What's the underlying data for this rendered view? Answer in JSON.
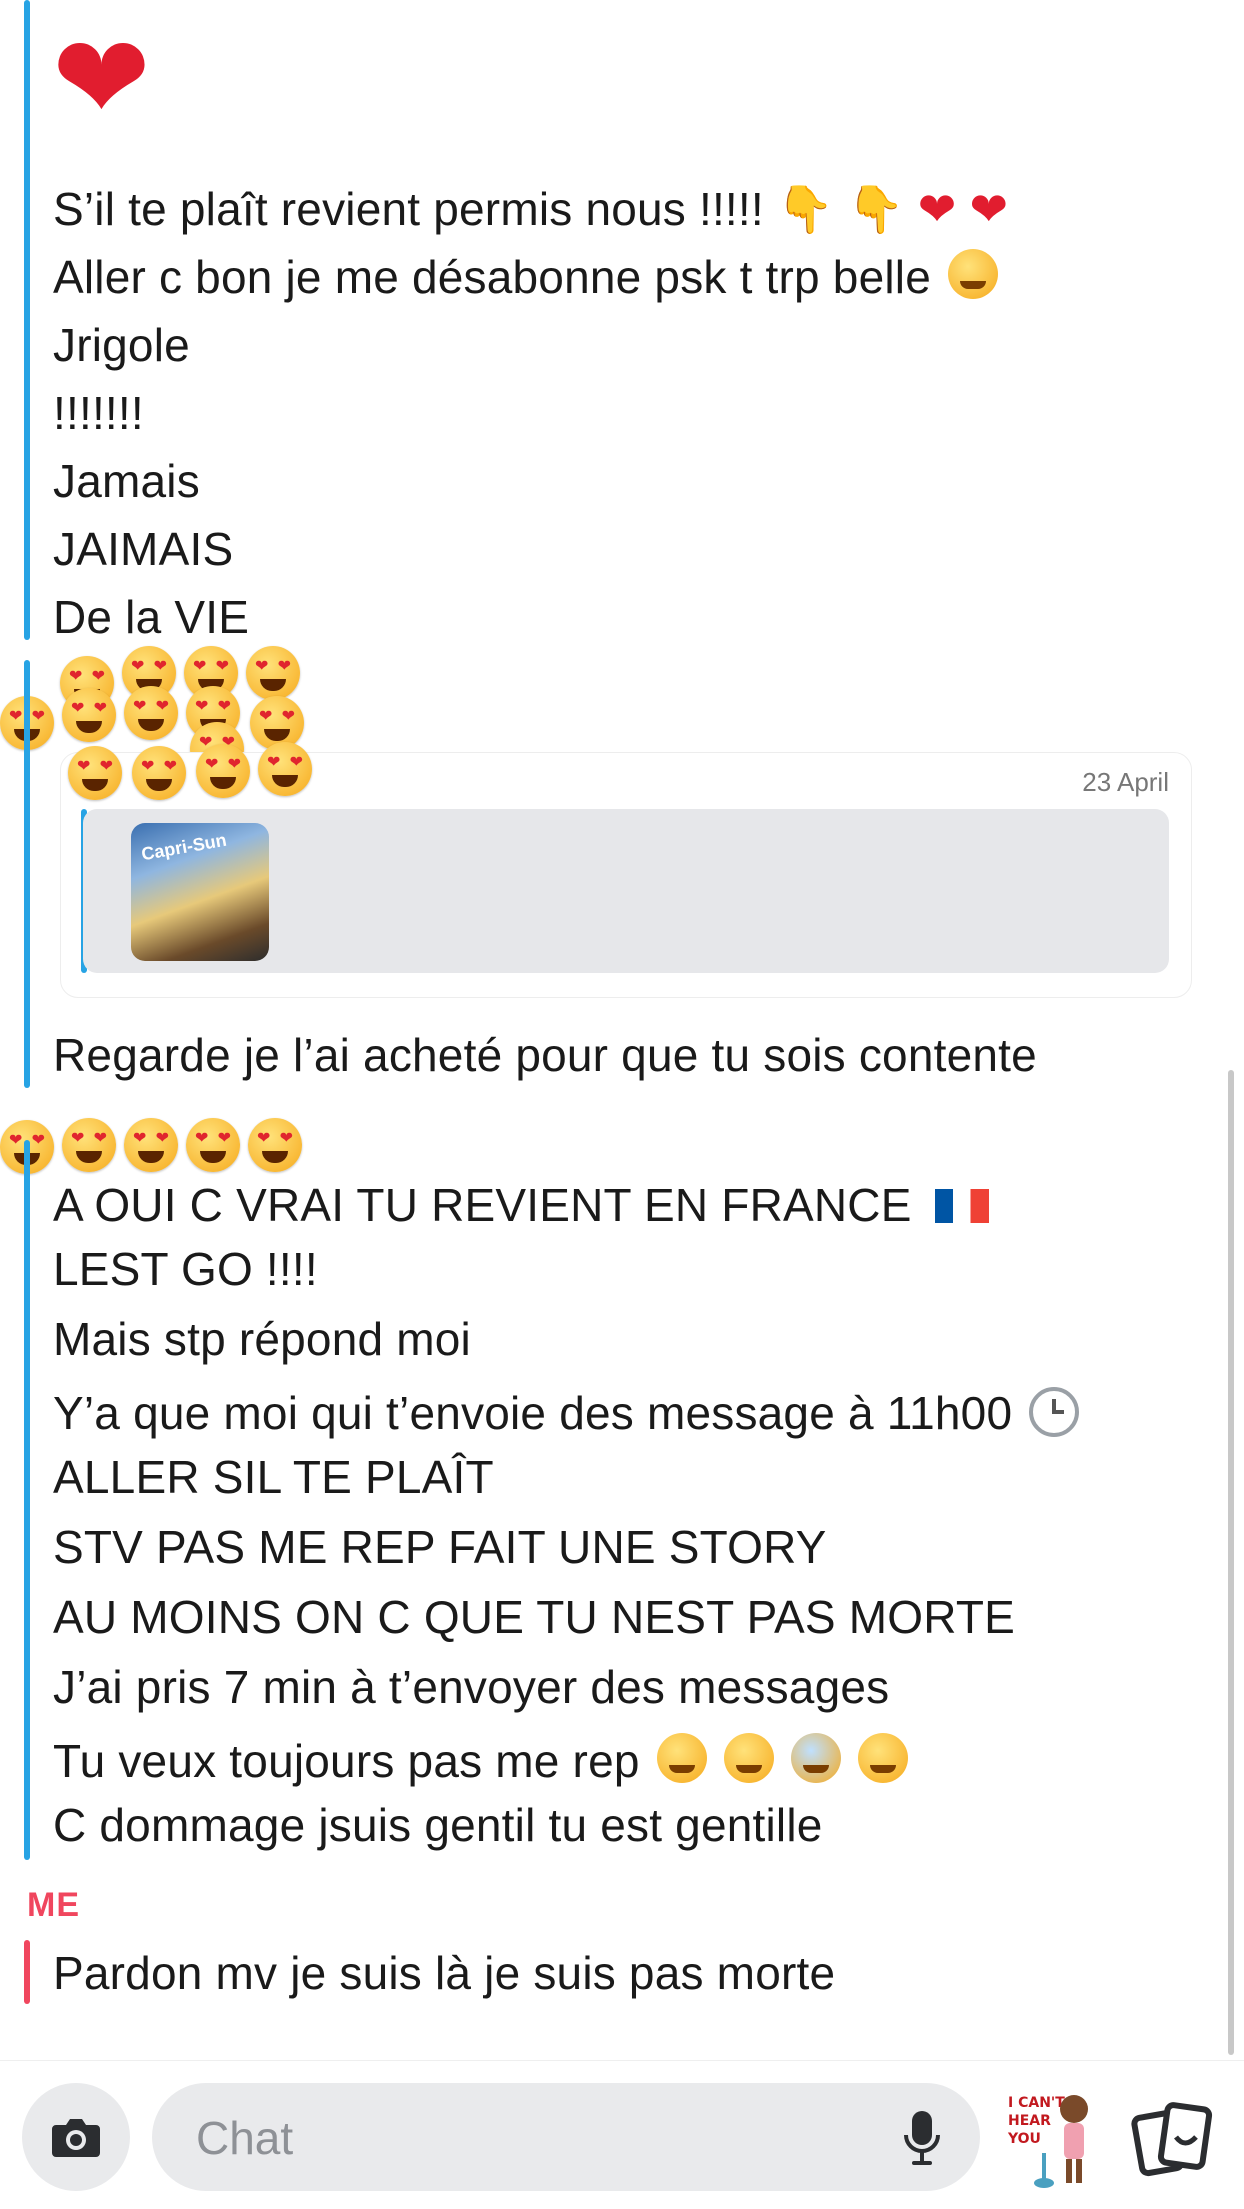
{
  "thread": {
    "big_heart": "❤",
    "block1": [
      "S’il te plaît revient permis nous !!!!!",
      "Aller c bon je me désabonne psk t trp belle",
      "Jrigole",
      "!!!!!!!",
      "Jamais",
      "JAIMAIS",
      "De la VIE"
    ],
    "block1_emoji": {
      "line1": "👇 👇 ❤ ❤",
      "line2": "🥰"
    },
    "shared_card": {
      "date": "23 April",
      "thumb_text": "Capri-Sun"
    },
    "block2": [
      "Regarde je l’ai acheté pour que tu sois contente"
    ],
    "block3": [
      "A OUI C VRAI TU REVIENT EN FRANCE",
      "LEST GO !!!!",
      "Mais stp répond moi",
      "Y’a que moi qui t’envoie des message à 11h00",
      "ALLER SIL TE PLAÎT",
      "STV PAS ME REP FAIT UNE STORY",
      "AU MOINS ON C QUE TU NEST PAS MORTE",
      "J’ai pris 7 min à t’envoyer des messages",
      "Tu veux toujours pas me rep",
      "C dommage jsuis gentil tu est gentille"
    ],
    "block3_emoji": {
      "france_flag": "🇫🇷",
      "clock": "🕐",
      "faces": "😔 😿 😨 🤭"
    },
    "me_label": "ME",
    "my_message": "Pardon mv je suis là je suis pas morte"
  },
  "bottom_bar": {
    "chat_placeholder": "Chat",
    "sticker_text": "I CAN'T HEAR YOU"
  },
  "colors": {
    "friend_accent": "#27a3e4",
    "me_accent": "#f0465e",
    "input_bg": "#e9eaec"
  },
  "icons": [
    "heart-icon",
    "point-down-icon",
    "heart-eyes-icon",
    "camera-icon",
    "microphone-icon",
    "sticker-icon",
    "cards-icon",
    "clock-icon",
    "france-flag-icon"
  ]
}
